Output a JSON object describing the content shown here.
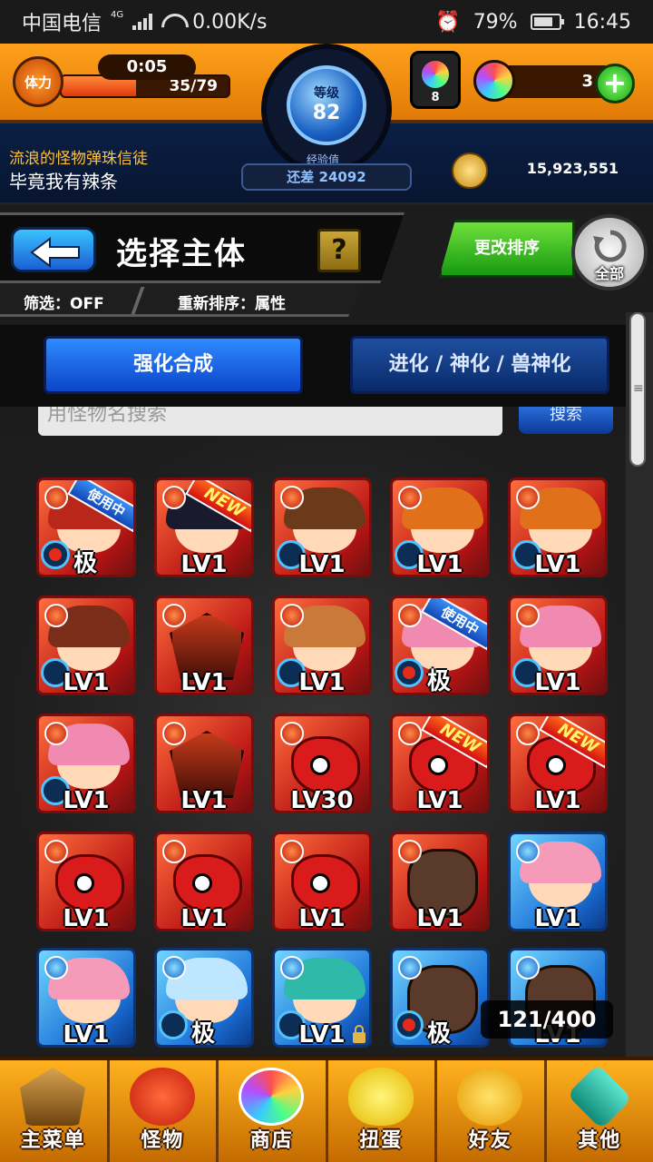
{
  "status_bar": {
    "carrier": "中国电信",
    "net_type": "4G",
    "speed": "0.00K/s",
    "battery": "79%",
    "battery_level": 0.79,
    "time": "16:45"
  },
  "stamina": {
    "badge": "体力",
    "timer": "0:05",
    "value": "35/79",
    "fraction": 0.443
  },
  "rank": {
    "label": "等级",
    "value": "82",
    "exp_label": "经验值",
    "exp_remaining": "还差 24092"
  },
  "orbs": {
    "inventory": "8",
    "count": "3",
    "plus": "+"
  },
  "player": {
    "title": "流浪的怪物弹珠信徒",
    "name": "毕竟我有辣条"
  },
  "coins": "15,923,551",
  "header": {
    "title": "选择主体",
    "help": "?",
    "filter": "筛选：OFF",
    "sort": "重新排序：属性",
    "reorder": "更改排序",
    "all": "全部"
  },
  "tabs": [
    {
      "label": "强化合成"
    },
    {
      "label": "进化 / 神化 / 兽神化"
    }
  ],
  "search": {
    "placeholder": "用怪物名搜索",
    "button": "搜索"
  },
  "monsters": [
    {
      "kind": "girl",
      "element": "fire",
      "hair": "#b9261a",
      "level": "极",
      "badge": "使用中",
      "sub": "red"
    },
    {
      "kind": "girl",
      "element": "fire",
      "hair": "#1a1a2e",
      "level": "LV1",
      "badge": "NEW",
      "sub": ""
    },
    {
      "kind": "girl",
      "element": "fire",
      "hair": "#6b3a1a",
      "level": "LV1",
      "badge": "",
      "sub": "blue"
    },
    {
      "kind": "girl",
      "element": "fire",
      "hair": "#e0701a",
      "level": "LV1",
      "badge": "",
      "sub": "blue"
    },
    {
      "kind": "girl",
      "element": "fire",
      "hair": "#e0701a",
      "level": "LV1",
      "badge": "",
      "sub": "blue"
    },
    {
      "kind": "girl",
      "element": "fire",
      "hair": "#7a2e1a",
      "level": "LV1",
      "badge": "",
      "sub": "blue"
    },
    {
      "kind": "mech",
      "element": "fire",
      "hair": "",
      "level": "LV1",
      "badge": "",
      "sub": ""
    },
    {
      "kind": "girl",
      "element": "fire",
      "hair": "#c97a3a",
      "level": "LV1",
      "badge": "",
      "sub": "blue"
    },
    {
      "kind": "girl",
      "element": "fire",
      "hair": "#f08ab0",
      "level": "极",
      "badge": "使用中",
      "sub": "red"
    },
    {
      "kind": "girl",
      "element": "fire",
      "hair": "#f08ab0",
      "level": "LV1",
      "badge": "",
      "sub": "blue"
    },
    {
      "kind": "girl",
      "element": "fire",
      "hair": "#f08ab0",
      "level": "LV1",
      "badge": "",
      "sub": "blue"
    },
    {
      "kind": "mech",
      "element": "fire",
      "hair": "",
      "level": "LV1",
      "badge": "",
      "sub": ""
    },
    {
      "kind": "dragon",
      "element": "fire",
      "hair": "",
      "level": "LV30",
      "badge": "",
      "sub": ""
    },
    {
      "kind": "dragon",
      "element": "fire",
      "hair": "",
      "level": "LV1",
      "badge": "NEW",
      "sub": ""
    },
    {
      "kind": "dragon",
      "element": "fire",
      "hair": "",
      "level": "LV1",
      "badge": "NEW",
      "sub": ""
    },
    {
      "kind": "dragon",
      "element": "fire",
      "hair": "",
      "level": "LV1",
      "badge": "",
      "sub": ""
    },
    {
      "kind": "dragon",
      "element": "fire",
      "hair": "",
      "level": "LV1",
      "badge": "",
      "sub": ""
    },
    {
      "kind": "dragon",
      "element": "fire",
      "hair": "",
      "level": "LV1",
      "badge": "",
      "sub": ""
    },
    {
      "kind": "beast",
      "element": "fire",
      "hair": "",
      "level": "LV1",
      "badge": "",
      "sub": ""
    },
    {
      "kind": "girl",
      "element": "water",
      "hair": "#f59ab8",
      "level": "LV1",
      "badge": "",
      "sub": ""
    },
    {
      "kind": "girl",
      "element": "water",
      "hair": "#f59ab8",
      "level": "LV1",
      "badge": "",
      "sub": ""
    },
    {
      "kind": "girl",
      "element": "water",
      "hair": "#bfe6ff",
      "level": "极",
      "badge": "",
      "sub": "blue"
    },
    {
      "kind": "girl",
      "element": "water",
      "hair": "#2fb9a8",
      "level": "LV1",
      "badge": "",
      "sub": "blue",
      "locked": true
    },
    {
      "kind": "beast",
      "element": "water",
      "hair": "",
      "level": "极",
      "badge": "",
      "sub": "red"
    },
    {
      "kind": "beast",
      "element": "water",
      "hair": "",
      "level": "LV1",
      "badge": "",
      "sub": ""
    }
  ],
  "box_count": "121/400",
  "bottom_nav": [
    {
      "label": "主菜单",
      "icon": "home-icon"
    },
    {
      "label": "怪物",
      "icon": "monster-icon"
    },
    {
      "label": "商店",
      "icon": "shop-icon"
    },
    {
      "label": "扭蛋",
      "icon": "gacha-icon"
    },
    {
      "label": "好友",
      "icon": "friends-icon"
    },
    {
      "label": "其他",
      "icon": "other-icon"
    }
  ],
  "colors": {
    "hud_orange": "#ffa11c",
    "tab_blue": "#0b45c9",
    "reorder_green": "#179a12",
    "fire": "#b81414",
    "water": "#1b6fd6"
  }
}
